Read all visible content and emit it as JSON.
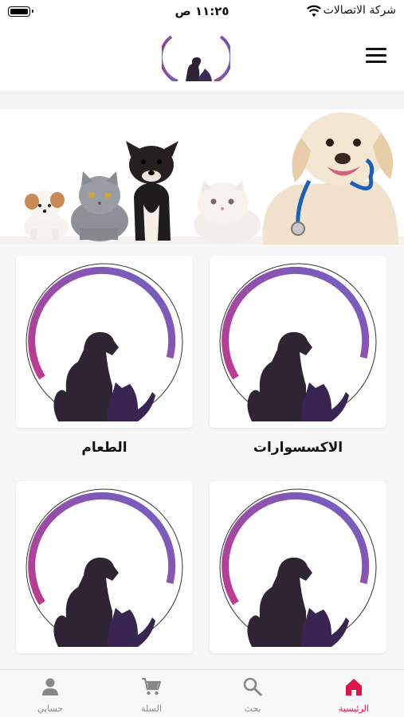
{
  "status_bar": {
    "time": "١١:٢٥ ص",
    "carrier": "شركة الاتصالات"
  },
  "header": {
    "logo_icon": "pet-clinic-logo-icon",
    "menu_icon": "hamburger-menu-icon"
  },
  "banner": {
    "image": "pets-banner-image"
  },
  "categories": [
    {
      "label": "الاكسسوارات",
      "icon": "dog-cat-logo-icon"
    },
    {
      "label": "الطعام",
      "icon": "dog-cat-logo-icon"
    },
    {
      "label": "",
      "icon": "dog-cat-logo-icon"
    },
    {
      "label": "",
      "icon": "dog-cat-logo-icon"
    }
  ],
  "tabs": [
    {
      "label": "الرئيسية",
      "icon": "home-icon",
      "active": true
    },
    {
      "label": "بحث",
      "icon": "search-icon",
      "active": false
    },
    {
      "label": "السلة",
      "icon": "cart-icon",
      "active": false
    },
    {
      "label": "حسابي",
      "icon": "person-icon",
      "active": false
    }
  ],
  "colors": {
    "accent": "#e0144c",
    "logo_purple": "#9b3fb5",
    "logo_violet": "#7a5bc8",
    "silhouette": "#2e2433"
  }
}
